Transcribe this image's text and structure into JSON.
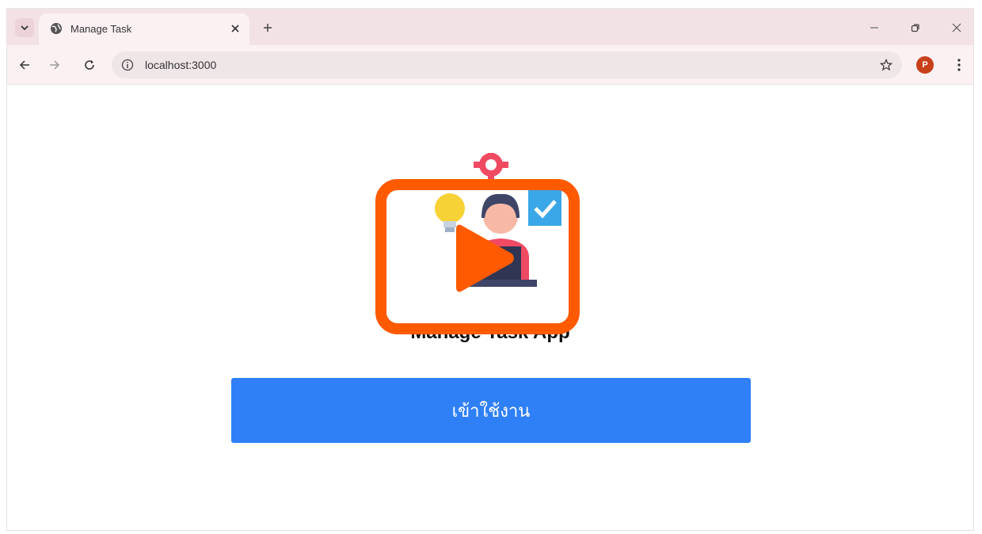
{
  "browser": {
    "tab_title": "Manage Task",
    "url": "localhost:3000",
    "profile_initial": "P"
  },
  "page": {
    "app_title": "Manage Task App",
    "login_button_label": "เข้าใช้งาน"
  },
  "colors": {
    "accent": "#2f80f7",
    "overlay": "#ff5a00",
    "tab_strip": "#f3e2e5"
  },
  "icons": [
    "tab-search-icon",
    "globe-icon",
    "close-icon",
    "plus-icon",
    "minimize-icon",
    "restore-icon",
    "back-icon",
    "forward-icon",
    "reload-icon",
    "site-info-icon",
    "star-icon",
    "kebab-menu-icon",
    "play-icon"
  ]
}
